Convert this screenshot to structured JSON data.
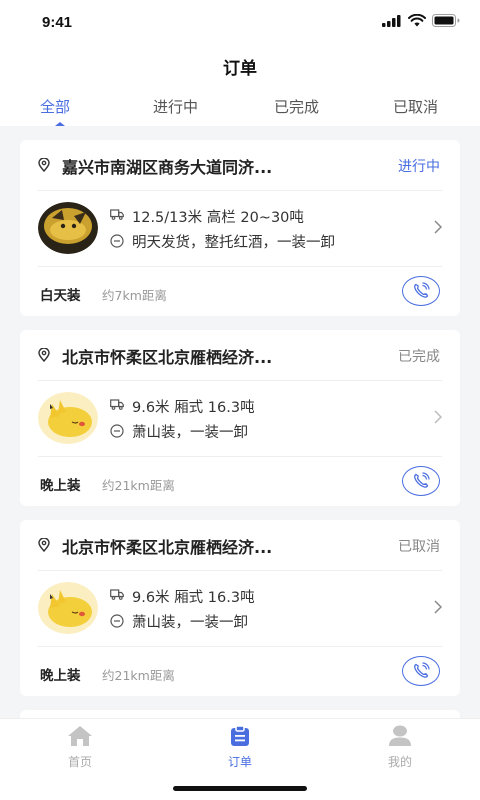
{
  "status_bar": {
    "time": "9:41"
  },
  "nav": {
    "title": "订单"
  },
  "tabs": [
    {
      "label": "全部",
      "active": true
    },
    {
      "label": "进行中",
      "active": false
    },
    {
      "label": "已完成",
      "active": false
    },
    {
      "label": "已取消",
      "active": false
    }
  ],
  "orders": [
    {
      "address": "嘉兴市南湖区商务大道同济...",
      "status": "进行中",
      "vehicle": "12.5/13米  高栏  20~30吨",
      "note": "明天发货，整托红酒，一装一卸",
      "load_time": "白天装",
      "distance": "约7km距离"
    },
    {
      "address": "北京市怀柔区北京雁栖经济...",
      "status": "已完成",
      "vehicle": "9.6米  厢式  16.3吨",
      "note": "萧山装，一装一卸",
      "load_time": "晚上装",
      "distance": "约21km距离"
    },
    {
      "address": "北京市怀柔区北京雁栖经济...",
      "status": "已取消",
      "vehicle": "9.6米  厢式  16.3吨",
      "note": "萧山装，一装一卸",
      "load_time": "晚上装",
      "distance": "约21km距离"
    }
  ],
  "bottom_tabs": [
    {
      "label": "首页",
      "icon": "home-icon",
      "active": false
    },
    {
      "label": "订单",
      "icon": "order-icon",
      "active": true
    },
    {
      "label": "我的",
      "icon": "profile-icon",
      "active": false
    }
  ],
  "colors": {
    "accent": "#4a6ee0",
    "background": "#f4f5f7",
    "muted": "#888888"
  }
}
